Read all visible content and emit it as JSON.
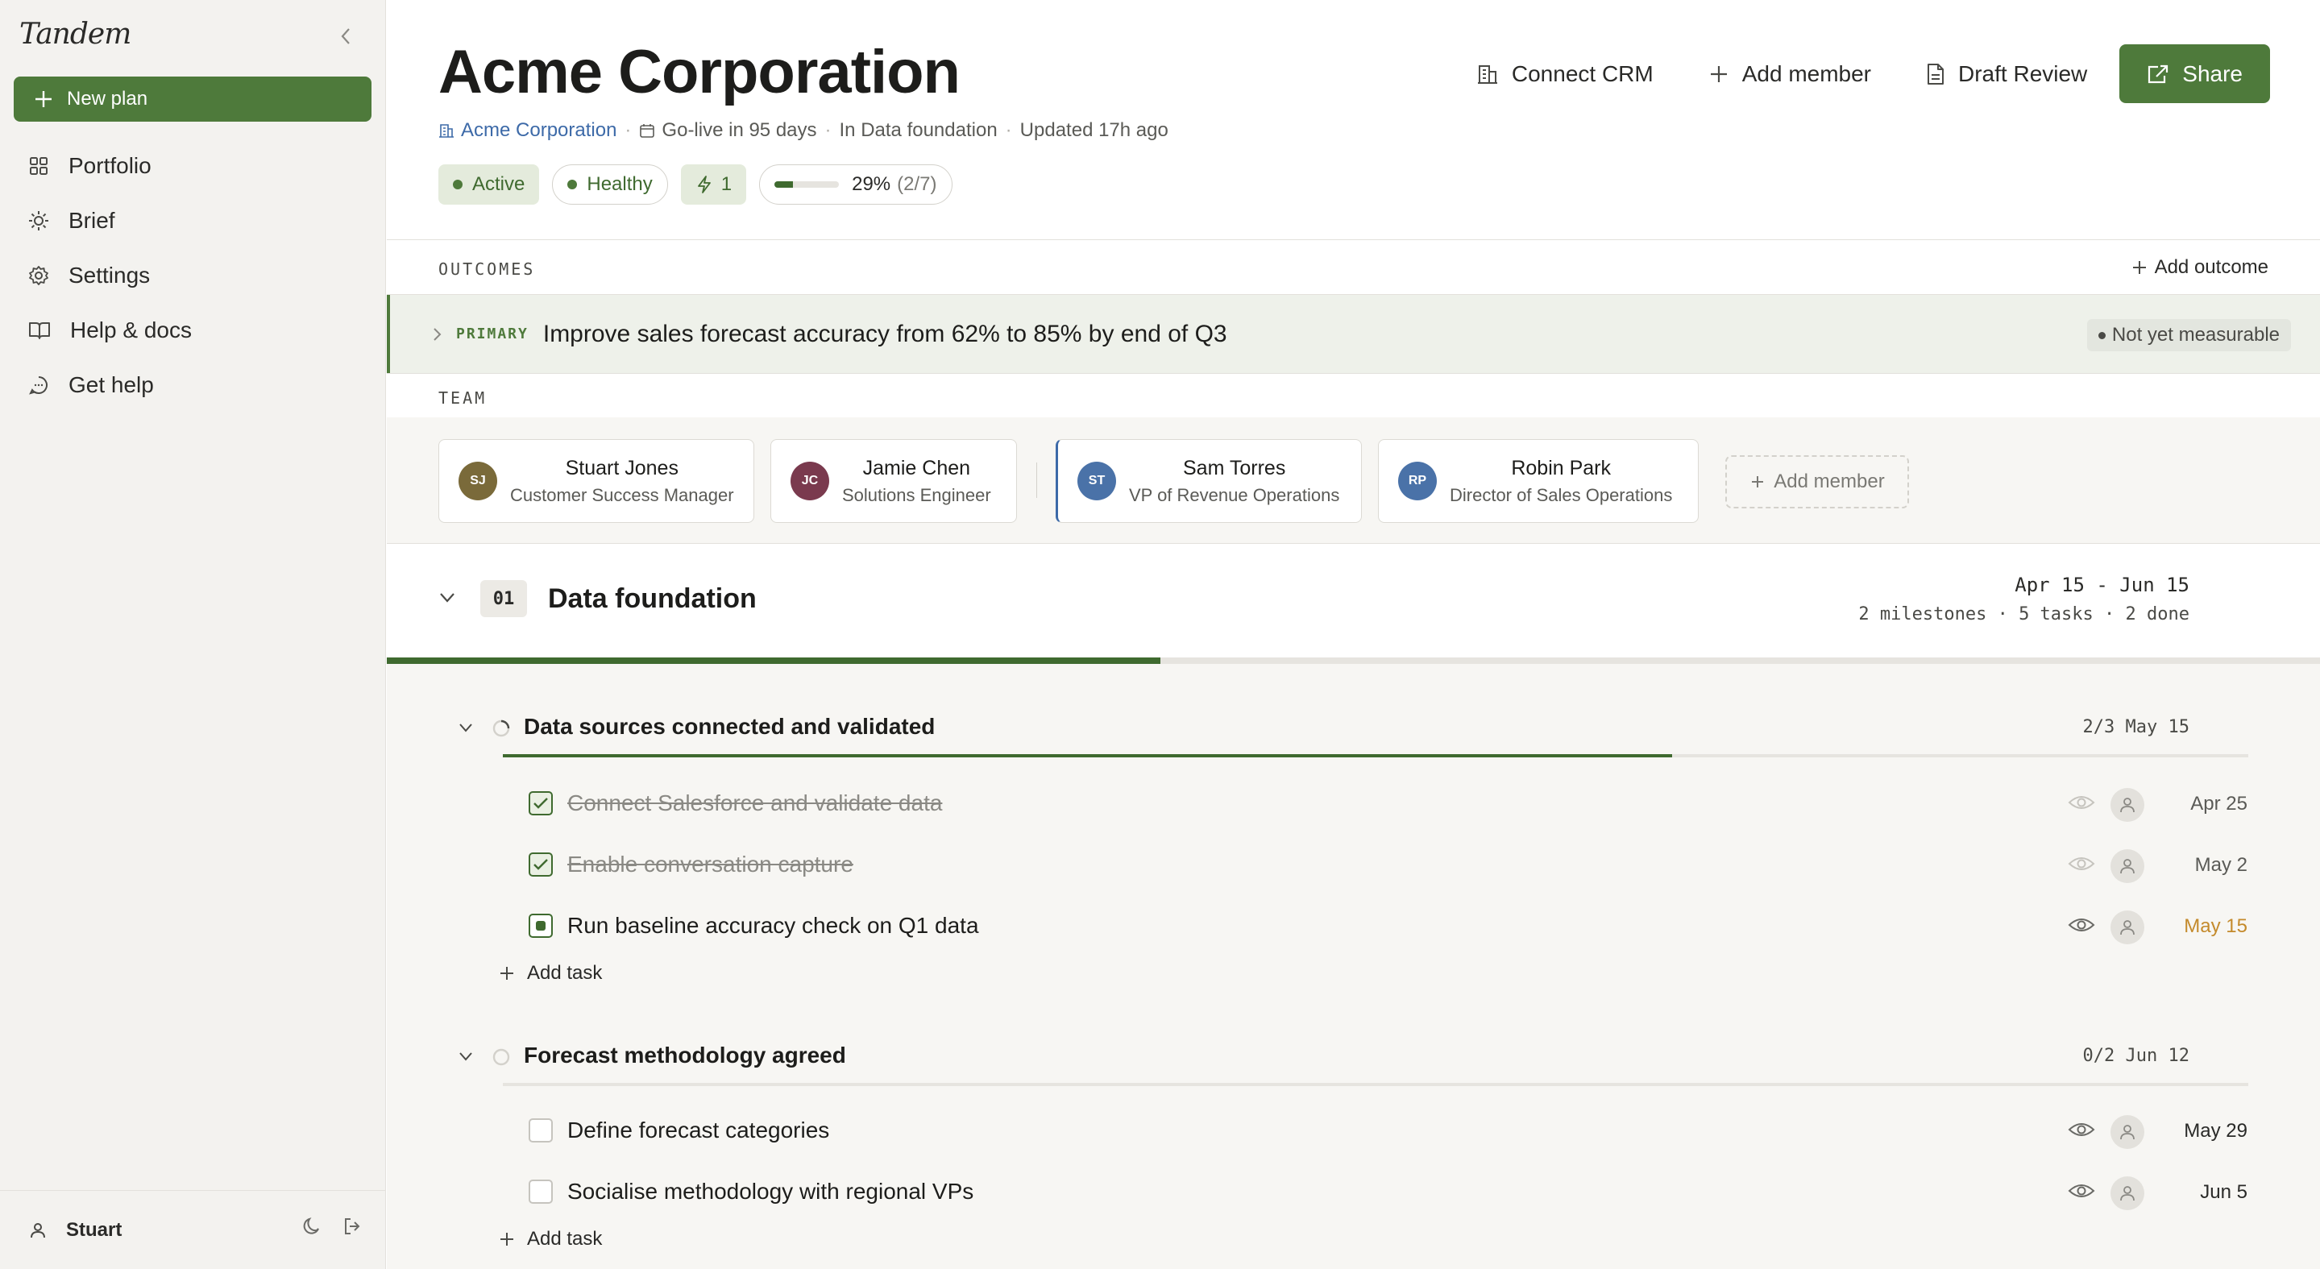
{
  "sidebar": {
    "brand": "Tandem",
    "new_plan_label": "New plan",
    "items": [
      {
        "label": "Portfolio",
        "icon": "grid-icon"
      },
      {
        "label": "Brief",
        "icon": "sun-icon"
      },
      {
        "label": "Settings",
        "icon": "gear-icon"
      },
      {
        "label": "Help & docs",
        "icon": "book-icon"
      },
      {
        "label": "Get help",
        "icon": "chat-icon"
      }
    ],
    "user_name": "Stuart"
  },
  "header": {
    "title": "Acme Corporation",
    "company_link": "Acme Corporation",
    "go_live": "Go-live in 95 days",
    "phase_status": "In Data foundation",
    "updated": "Updated 17h ago",
    "actions": {
      "connect_crm": "Connect CRM",
      "add_member": "Add member",
      "draft_review": "Draft Review",
      "share": "Share"
    },
    "badges": {
      "status": "Active",
      "health": "Healthy",
      "alerts": "1",
      "progress_percent": "29%",
      "progress_count": "(2/7)",
      "progress_fraction": 0.29
    }
  },
  "outcomes": {
    "label": "OUTCOMES",
    "add_label": "Add outcome",
    "primary": {
      "tag": "PRIMARY",
      "text": "Improve sales forecast accuracy from 62% to 85% by end of Q3",
      "status": "Not yet measurable"
    }
  },
  "team": {
    "label": "TEAM",
    "members": [
      {
        "initials": "SJ",
        "name": "Stuart Jones",
        "role": "Customer Success Manager",
        "color": "#7a6a3a"
      },
      {
        "initials": "JC",
        "name": "Jamie Chen",
        "role": "Solutions Engineer",
        "color": "#7a3a4e"
      },
      {
        "initials": "ST",
        "name": "Sam Torres",
        "role": "VP of Revenue Operations",
        "color": "#4a72a8"
      },
      {
        "initials": "RP",
        "name": "Robin Park",
        "role": "Director of Sales Operations",
        "color": "#4a72a8"
      }
    ],
    "add_member_label": "Add member"
  },
  "phase": {
    "number": "01",
    "title": "Data foundation",
    "dates": "Apr 15 - Jun 15",
    "stats": "2 milestones · 5 tasks · 2 done",
    "progress_fraction": 0.4,
    "milestones": [
      {
        "title": "Data sources connected and validated",
        "meta": "2/3 May 15",
        "progress_fraction": 0.67,
        "tasks": [
          {
            "name": "Connect Salesforce and validate data",
            "date": "Apr 25",
            "state": "done"
          },
          {
            "name": "Enable conversation capture",
            "date": "May 2",
            "state": "done"
          },
          {
            "name": "Run baseline accuracy check on Q1 data",
            "date": "May 15",
            "state": "in-progress"
          }
        ],
        "add_task_label": "Add task"
      },
      {
        "title": "Forecast methodology agreed",
        "meta": "0/2 Jun 12",
        "progress_fraction": 0,
        "tasks": [
          {
            "name": "Define forecast categories",
            "date": "May 29",
            "state": "todo"
          },
          {
            "name": "Socialise methodology with regional VPs",
            "date": "Jun 5",
            "state": "todo"
          }
        ],
        "add_task_label": "Add task"
      }
    ]
  }
}
